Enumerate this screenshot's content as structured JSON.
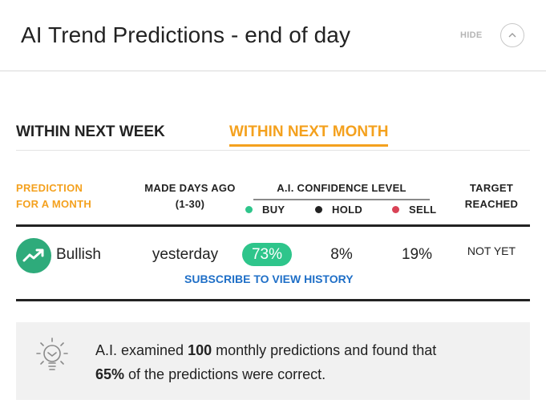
{
  "header": {
    "title": "AI Trend Predictions - end of day",
    "hide_label": "HIDE",
    "collapse_icon": "chevron-up-icon"
  },
  "tabs": [
    {
      "label": "WITHIN NEXT WEEK",
      "active": false
    },
    {
      "label": "WITHIN NEXT MONTH",
      "active": true
    }
  ],
  "table": {
    "headers": {
      "prediction_line1": "PREDICTION",
      "prediction_line2": "FOR A MONTH",
      "made_line1": "MADE DAYS AGO",
      "made_line2": "(1-30)",
      "confidence": "A.I. CONFIDENCE LEVEL",
      "buy": "BUY",
      "hold": "HOLD",
      "sell": "SELL",
      "target_line1": "TARGET",
      "target_line2": "REACHED"
    },
    "row": {
      "trend": "Bullish",
      "trend_icon": "trending-up-icon",
      "made": "yesterday",
      "buy": "73%",
      "hold": "8%",
      "sell": "19%",
      "target": "NOT YET"
    },
    "subscribe_link": "SUBSCRIBE TO VIEW HISTORY"
  },
  "insight": {
    "icon": "lightbulb-icon",
    "text_1": "A.I. examined ",
    "count": "100",
    "text_2": " monthly predictions and found that",
    "percent": "65%",
    "text_3": " of the predictions were correct."
  },
  "colors": {
    "accent_orange": "#f4a11e",
    "buy_green": "#2ec58b",
    "hold_dark": "#222222",
    "sell_red": "#d94256",
    "link_blue": "#1f6fc7",
    "trend_green": "#2eab7b"
  }
}
